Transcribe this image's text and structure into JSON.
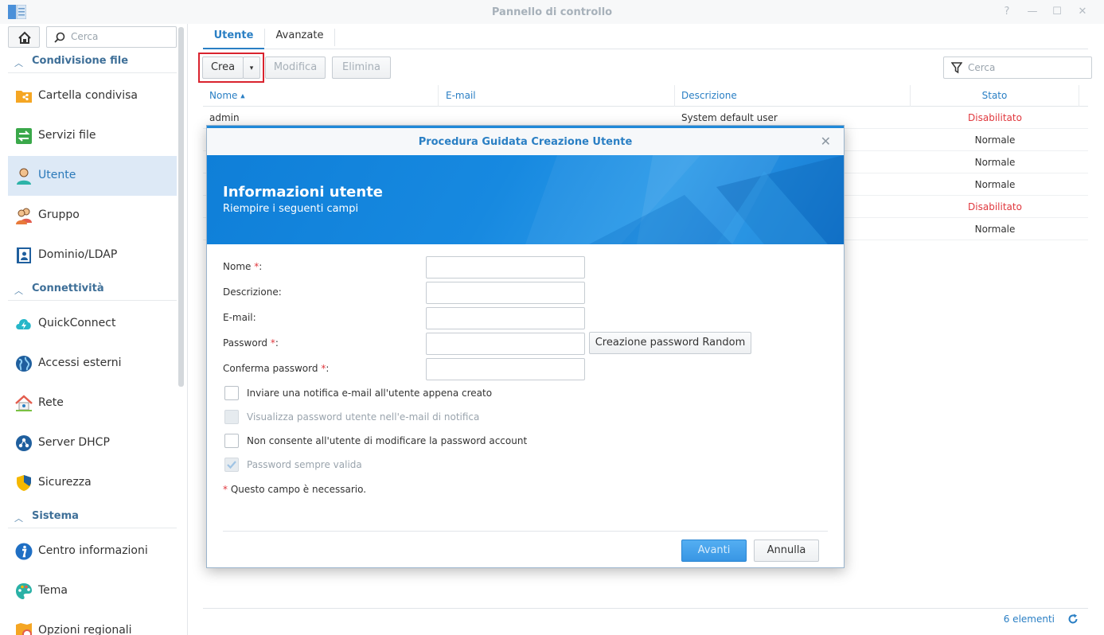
{
  "window": {
    "title": "Pannello di controllo",
    "controls": [
      "?",
      "—",
      "☐",
      "✕"
    ]
  },
  "sidebar": {
    "search_placeholder": "Cerca",
    "sections": [
      {
        "label": "Condivisione file"
      },
      {
        "label": "Connettività"
      },
      {
        "label": "Sistema"
      }
    ],
    "items": [
      {
        "label": "Cartella condivisa",
        "icon": "shared-folder-icon"
      },
      {
        "label": "Servizi file",
        "icon": "file-services-icon"
      },
      {
        "label": "Utente",
        "icon": "user-icon",
        "active": true
      },
      {
        "label": "Gruppo",
        "icon": "group-icon"
      },
      {
        "label": "Dominio/LDAP",
        "icon": "domain-ldap-icon"
      },
      {
        "label": "QuickConnect",
        "icon": "quickconnect-icon"
      },
      {
        "label": "Accessi esterni",
        "icon": "external-access-icon"
      },
      {
        "label": "Rete",
        "icon": "network-icon"
      },
      {
        "label": "Server DHCP",
        "icon": "dhcp-server-icon"
      },
      {
        "label": "Sicurezza",
        "icon": "security-icon"
      },
      {
        "label": "Centro informazioni",
        "icon": "info-center-icon"
      },
      {
        "label": "Tema",
        "icon": "theme-icon"
      },
      {
        "label": "Opzioni regionali",
        "icon": "regional-options-icon"
      }
    ]
  },
  "main": {
    "tabs": [
      {
        "label": "Utente",
        "active": true
      },
      {
        "label": "Avanzate"
      }
    ],
    "toolbar": {
      "create_label": "Crea",
      "edit_label": "Modifica",
      "delete_label": "Elimina",
      "search_placeholder": "Cerca"
    },
    "columns": [
      "Nome",
      "E-mail",
      "Descrizione",
      "Stato"
    ],
    "sort_indicator": "▲",
    "rows": [
      {
        "name": "admin",
        "email": "",
        "description": "System default user",
        "status": "Disabilitato"
      },
      {
        "name": "",
        "email": "",
        "description": "",
        "status": "Normale"
      },
      {
        "name": "",
        "email": "",
        "description": "",
        "status": "Normale"
      },
      {
        "name": "",
        "email": "",
        "description": "",
        "status": "Normale"
      },
      {
        "name": "",
        "email": "",
        "description": "",
        "status": "Disabilitato"
      },
      {
        "name": "",
        "email": "",
        "description": "",
        "status": "Normale"
      }
    ],
    "footer_count": "6 elementi"
  },
  "dialog": {
    "title": "Procedura Guidata Creazione Utente",
    "banner_title": "Informazioni utente",
    "banner_subtitle": "Riempire i seguenti campi",
    "fields": {
      "name": {
        "label": "Nome",
        "required": "*",
        "suffix": ":",
        "value": ""
      },
      "description": {
        "label": "Descrizione:",
        "value": ""
      },
      "email": {
        "label": "E-mail:",
        "value": ""
      },
      "password": {
        "label": "Password",
        "required": "*",
        "suffix": ":",
        "value": ""
      },
      "confirm": {
        "label": "Conferma password",
        "required": "*",
        "suffix": ":",
        "value": ""
      }
    },
    "random_password_label": "Creazione password Random",
    "checkboxes": [
      {
        "label": "Inviare una notifica e-mail all'utente appena creato",
        "checked": false,
        "disabled": false
      },
      {
        "label": "Visualizza password utente nell'e-mail di notifica",
        "checked": false,
        "disabled": true
      },
      {
        "label": "Non consente all'utente di modificare la password account",
        "checked": false,
        "disabled": false
      },
      {
        "label": "Password sempre valida",
        "checked": true,
        "disabled": true
      }
    ],
    "required_note_star": "*",
    "required_note": "Questo campo è necessario.",
    "next_label": "Avanti",
    "cancel_label": "Annulla"
  },
  "colors": {
    "accent": "#2a7fc4",
    "disabled_status": "#e0383e",
    "highlight_box": "#d9232e"
  }
}
